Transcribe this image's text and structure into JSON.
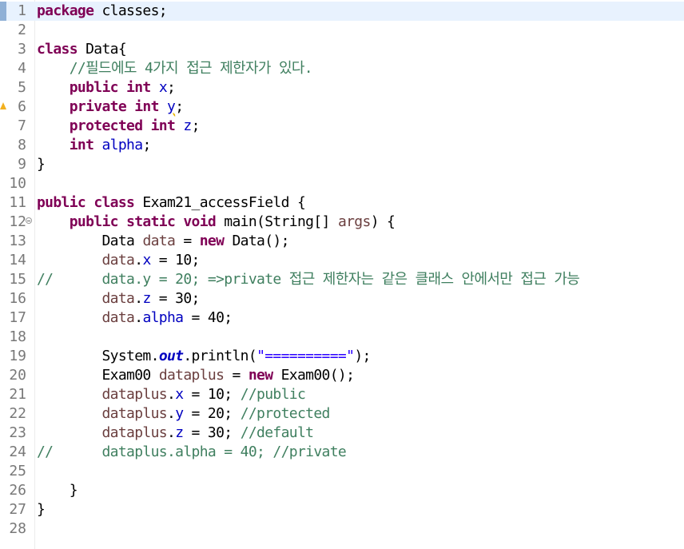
{
  "editor": {
    "lines": [
      {
        "n": "1",
        "tokens": [
          {
            "t": "package",
            "c": "kw"
          },
          {
            "t": " classes;"
          }
        ]
      },
      {
        "n": "2",
        "tokens": []
      },
      {
        "n": "3",
        "tokens": [
          {
            "t": "class",
            "c": "kw"
          },
          {
            "t": " Data{"
          }
        ]
      },
      {
        "n": "4",
        "tokens": [
          {
            "t": "    "
          },
          {
            "t": "//필드에도 4가지 접근 제한자가 있다.",
            "c": "cm"
          }
        ]
      },
      {
        "n": "5",
        "tokens": [
          {
            "t": "    "
          },
          {
            "t": "public",
            "c": "kw"
          },
          {
            "t": " "
          },
          {
            "t": "int",
            "c": "kw"
          },
          {
            "t": " "
          },
          {
            "t": "x",
            "c": "fld"
          },
          {
            "t": ";"
          }
        ]
      },
      {
        "n": "6",
        "tokens": [
          {
            "t": "    "
          },
          {
            "t": "private",
            "c": "kw"
          },
          {
            "t": " "
          },
          {
            "t": "int",
            "c": "kw"
          },
          {
            "t": " "
          },
          {
            "t": "y",
            "c": "fld warn-u"
          },
          {
            "t": ";"
          }
        ]
      },
      {
        "n": "7",
        "tokens": [
          {
            "t": "    "
          },
          {
            "t": "protected",
            "c": "kw"
          },
          {
            "t": " "
          },
          {
            "t": "int",
            "c": "kw"
          },
          {
            "t": " "
          },
          {
            "t": "z",
            "c": "fld"
          },
          {
            "t": ";"
          }
        ]
      },
      {
        "n": "8",
        "tokens": [
          {
            "t": "    "
          },
          {
            "t": "int",
            "c": "kw"
          },
          {
            "t": " "
          },
          {
            "t": "alpha",
            "c": "fld"
          },
          {
            "t": ";"
          }
        ]
      },
      {
        "n": "9",
        "tokens": [
          {
            "t": "}"
          }
        ]
      },
      {
        "n": "10",
        "tokens": []
      },
      {
        "n": "11",
        "tokens": [
          {
            "t": "public",
            "c": "kw"
          },
          {
            "t": " "
          },
          {
            "t": "class",
            "c": "kw"
          },
          {
            "t": " Exam21_accessField {"
          }
        ]
      },
      {
        "n": "12",
        "tokens": [
          {
            "t": "    "
          },
          {
            "t": "public",
            "c": "kw"
          },
          {
            "t": " "
          },
          {
            "t": "static",
            "c": "kw"
          },
          {
            "t": " "
          },
          {
            "t": "void",
            "c": "kw"
          },
          {
            "t": " main(String[] "
          },
          {
            "t": "args",
            "c": "var"
          },
          {
            "t": ") {"
          }
        ]
      },
      {
        "n": "13",
        "tokens": [
          {
            "t": "        Data "
          },
          {
            "t": "data",
            "c": "var"
          },
          {
            "t": " = "
          },
          {
            "t": "new",
            "c": "kw"
          },
          {
            "t": " Data();"
          }
        ]
      },
      {
        "n": "14",
        "tokens": [
          {
            "t": "        "
          },
          {
            "t": "data",
            "c": "var"
          },
          {
            "t": "."
          },
          {
            "t": "x",
            "c": "fld"
          },
          {
            "t": " = 10;"
          }
        ]
      },
      {
        "n": "15",
        "tokens": [
          {
            "t": "//      data.y = 20; =>private 접근 제한자는 같은 클래스 안에서만 접근 가능",
            "c": "cm"
          }
        ]
      },
      {
        "n": "16",
        "tokens": [
          {
            "t": "        "
          },
          {
            "t": "data",
            "c": "var"
          },
          {
            "t": "."
          },
          {
            "t": "z",
            "c": "fld"
          },
          {
            "t": " = 30;"
          }
        ]
      },
      {
        "n": "17",
        "tokens": [
          {
            "t": "        "
          },
          {
            "t": "data",
            "c": "var"
          },
          {
            "t": "."
          },
          {
            "t": "alpha",
            "c": "fld"
          },
          {
            "t": " = 40;"
          }
        ]
      },
      {
        "n": "18",
        "tokens": []
      },
      {
        "n": "19",
        "tokens": [
          {
            "t": "        System."
          },
          {
            "t": "out",
            "c": "sf"
          },
          {
            "t": ".println("
          },
          {
            "t": "\"==========\"",
            "c": "str"
          },
          {
            "t": ");"
          }
        ]
      },
      {
        "n": "20",
        "tokens": [
          {
            "t": "        Exam00 "
          },
          {
            "t": "dataplus",
            "c": "var"
          },
          {
            "t": " = "
          },
          {
            "t": "new",
            "c": "kw"
          },
          {
            "t": " Exam00();"
          }
        ]
      },
      {
        "n": "21",
        "tokens": [
          {
            "t": "        "
          },
          {
            "t": "dataplus",
            "c": "var"
          },
          {
            "t": "."
          },
          {
            "t": "x",
            "c": "fld"
          },
          {
            "t": " = 10; "
          },
          {
            "t": "//public",
            "c": "cm"
          }
        ]
      },
      {
        "n": "22",
        "tokens": [
          {
            "t": "        "
          },
          {
            "t": "dataplus",
            "c": "var"
          },
          {
            "t": "."
          },
          {
            "t": "y",
            "c": "fld"
          },
          {
            "t": " = 20; "
          },
          {
            "t": "//protected",
            "c": "cm"
          }
        ]
      },
      {
        "n": "23",
        "tokens": [
          {
            "t": "        "
          },
          {
            "t": "dataplus",
            "c": "var"
          },
          {
            "t": "."
          },
          {
            "t": "z",
            "c": "fld"
          },
          {
            "t": " = 30; "
          },
          {
            "t": "//default",
            "c": "cm"
          }
        ]
      },
      {
        "n": "24",
        "tokens": [
          {
            "t": "//      dataplus.alpha = 40; //private",
            "c": "cm"
          }
        ]
      },
      {
        "n": "25",
        "tokens": []
      },
      {
        "n": "26",
        "tokens": [
          {
            "t": "    }"
          }
        ]
      },
      {
        "n": "27",
        "tokens": [
          {
            "t": "}"
          }
        ]
      },
      {
        "n": "28",
        "tokens": []
      }
    ],
    "current_line": "1",
    "fold_lines": [
      "12"
    ],
    "warning_lines": [
      "6"
    ],
    "bookmark_lines": [
      "1"
    ],
    "colors": {
      "keyword": "#7f0055",
      "field": "#0000c0",
      "local_variable": "#6a3e3e",
      "comment": "#3f7f5f",
      "string": "#2a00ff",
      "line_number": "#787878",
      "current_line_bg": "#e8f2fe"
    }
  }
}
